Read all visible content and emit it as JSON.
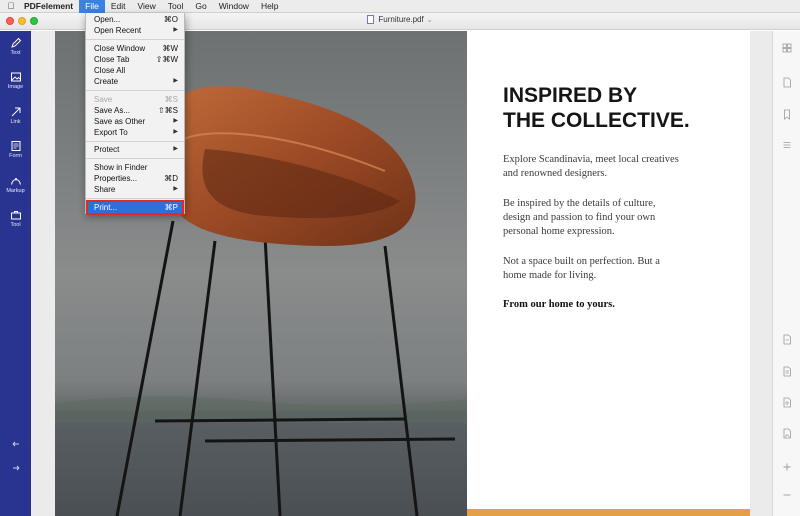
{
  "menubar": {
    "apple_icon": "apple-logo-icon",
    "items": [
      {
        "label": "PDFelement"
      },
      {
        "label": "File"
      },
      {
        "label": "Edit"
      },
      {
        "label": "View"
      },
      {
        "label": "Tool"
      },
      {
        "label": "Go"
      },
      {
        "label": "Window"
      },
      {
        "label": "Help"
      }
    ]
  },
  "window": {
    "title": "Furniture.pdf"
  },
  "sidebar": {
    "tools": [
      {
        "label": "Text",
        "icon": "pen-icon"
      },
      {
        "label": "Image",
        "icon": "image-icon"
      },
      {
        "label": "Link",
        "icon": "link-icon"
      },
      {
        "label": "Form",
        "icon": "form-icon"
      },
      {
        "label": "Markup",
        "icon": "markup-icon"
      },
      {
        "label": "Tool",
        "icon": "toolbox-icon"
      }
    ]
  },
  "file_menu": {
    "items": [
      {
        "label": "Open...",
        "shortcut": "⌘O"
      },
      {
        "label": "Open Recent",
        "submenu": true
      },
      {
        "label": "Close Window",
        "shortcut": "⌘W"
      },
      {
        "label": "Close Tab",
        "shortcut": "⇧⌘W"
      },
      {
        "label": "Close All"
      },
      {
        "label": "Create",
        "submenu": true
      },
      {
        "label": "Save",
        "shortcut": "⌘S",
        "disabled": true
      },
      {
        "label": "Save As...",
        "shortcut": "⇧⌘S"
      },
      {
        "label": "Save as Other",
        "submenu": true
      },
      {
        "label": "Export To",
        "submenu": true
      },
      {
        "label": "Protect",
        "submenu": true
      },
      {
        "label": "Show in Finder"
      },
      {
        "label": "Properties...",
        "shortcut": "⌘D"
      },
      {
        "label": "Share",
        "submenu": true
      },
      {
        "label": "Print...",
        "shortcut": "⌘P",
        "highlighted": true
      }
    ]
  },
  "document": {
    "headline": [
      "INSPIRED BY",
      "THE COLLECTIVE."
    ],
    "paragraphs": [
      [
        "Explore Scandinavia, meet local creatives",
        "and renowned designers."
      ],
      [
        "Be inspired by the details of culture,",
        "design and passion to find your own",
        "personal home expression."
      ],
      [
        "Not a space built on perfection. But a",
        "home made for living."
      ]
    ],
    "closing": "From our home to yours.",
    "image": "leather-bar-stool-photo"
  },
  "colors": {
    "sidebar": "#28348f",
    "menu_highlight": "#2f6fd8",
    "highlight_outline": "#e02a2a",
    "accent_bar": "#e3a046"
  }
}
